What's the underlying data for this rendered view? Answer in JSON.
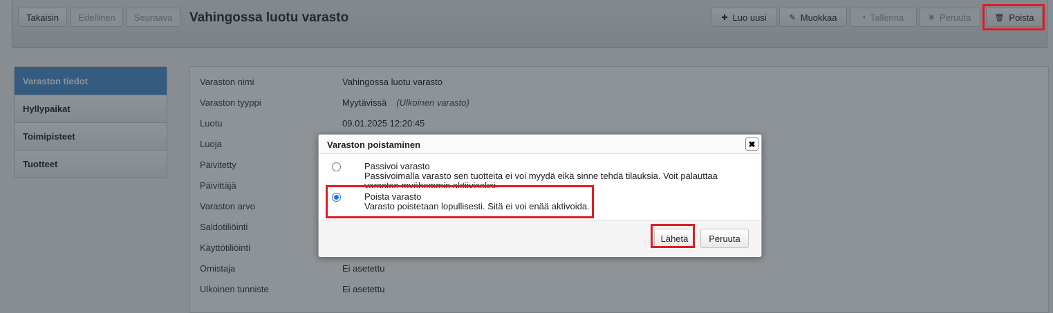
{
  "toolbar": {
    "back_label": "Takaisin",
    "prev_label": "Edellinen",
    "next_label": "Seuraava",
    "title": "Vahingossa luotu varasto",
    "create_label": "Luo uusi",
    "edit_label": "Muokkaa",
    "save_label": "Tallenna",
    "cancel_label": "Peruuta",
    "delete_label": "Poista",
    "icons": {
      "create": "plus-icon",
      "edit": "pencil-icon",
      "save": "floppy-icon",
      "cancel": "x-icon",
      "delete": "trash-icon"
    }
  },
  "sidebar": {
    "items": [
      {
        "label": "Varaston tiedot",
        "active": true
      },
      {
        "label": "Hyllypaikat",
        "active": false
      },
      {
        "label": "Toimipisteet",
        "active": false
      },
      {
        "label": "Tuotteet",
        "active": false
      }
    ]
  },
  "details": {
    "rows": [
      {
        "label": "Varaston nimi",
        "value": "Vahingossa luotu varasto"
      },
      {
        "label": "Varaston tyyppi",
        "value": "Myytävissä",
        "note": "(Ulkoinen varasto)"
      },
      {
        "label": "Luotu",
        "value": "09.01.2025 12:20:45"
      },
      {
        "label": "Luoja",
        "value": ""
      },
      {
        "label": "Päivitetty",
        "value": ""
      },
      {
        "label": "Päivittäjä",
        "value": ""
      },
      {
        "label": "Varaston arvo",
        "value": ""
      },
      {
        "label": "Saldotiliöinti",
        "value": ""
      },
      {
        "label": "Käyttötiliöinti",
        "value": ""
      },
      {
        "label": "Omistaja",
        "value": "Ei asetettu"
      },
      {
        "label": "Ulkoinen tunniste",
        "value": "Ei asetettu"
      }
    ]
  },
  "dialog": {
    "title": "Varaston poistaminen",
    "close_symbol": "✖",
    "options": [
      {
        "title": "Passivoi varasto",
        "description": "Passivoimalla varasto sen tuotteita ei voi myydä eikä sinne tehdä tilauksia. Voit palauttaa varaston myöhemmin aktiiviseksi.",
        "selected": false
      },
      {
        "title": "Poista varasto",
        "description": "Varasto poistetaan lopullisesti. Sitä ei voi enää aktivoida.",
        "selected": true
      }
    ],
    "submit_label": "Lähetä",
    "cancel_label": "Peruuta"
  },
  "colors": {
    "accent": "#4a90d2",
    "highlight": "#e01b24",
    "radio_selected": "#1a73e8"
  }
}
